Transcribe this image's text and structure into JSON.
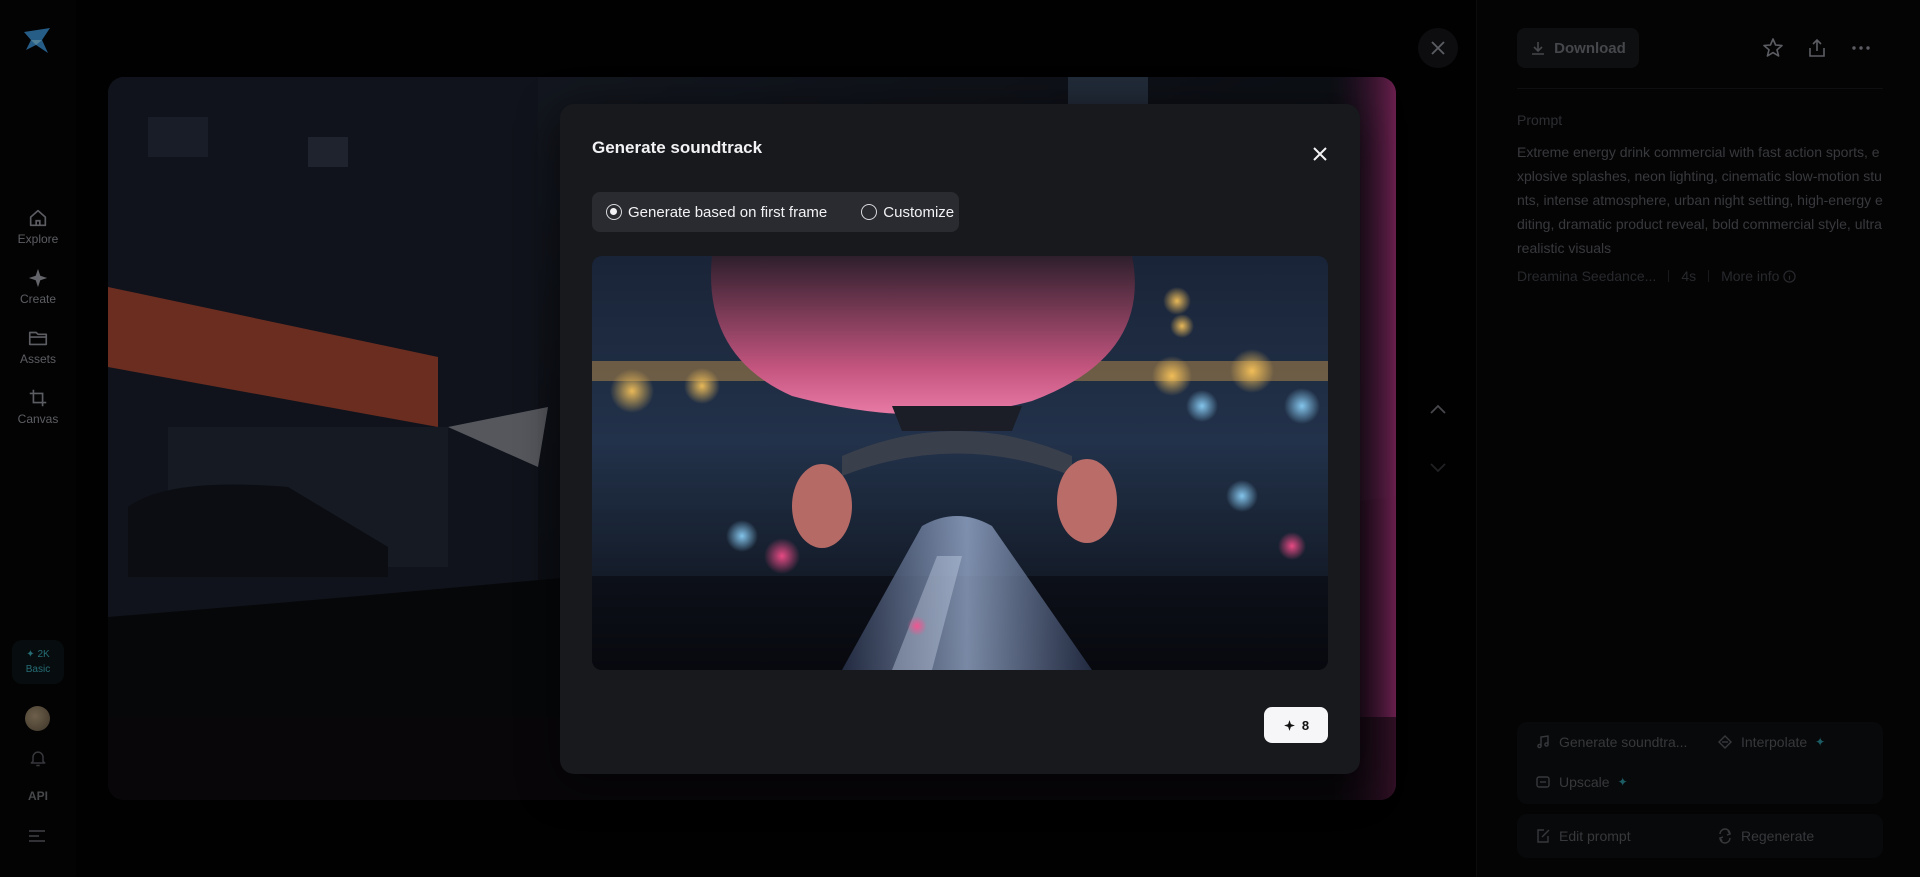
{
  "nav": {
    "items": [
      {
        "label": "Explore",
        "icon": "home-icon"
      },
      {
        "label": "Create",
        "icon": "sparkle-icon"
      },
      {
        "label": "Assets",
        "icon": "folder-icon"
      },
      {
        "label": "Canvas",
        "icon": "crop-icon"
      }
    ],
    "credits": {
      "amount": "✦ 2K",
      "plan": "Basic"
    },
    "api_label": "API"
  },
  "right_panel": {
    "download_label": "Download",
    "prompt_label": "Prompt",
    "prompt_text": "Extreme energy drink commercial with fast action sports, explosive splashes, neon lighting, cinematic slow-motion stunts, intense atmosphere, urban night setting, high-energy editing, dramatic product reveal, bold commercial style, ultra realistic visuals",
    "model": "Dreamina Seedance...",
    "duration": "4s",
    "more_info": "More info",
    "actions": {
      "generate_soundtrack": "Generate soundtra...",
      "interpolate": "Interpolate",
      "upscale": "Upscale",
      "edit_prompt": "Edit prompt",
      "regenerate": "Regenerate"
    }
  },
  "modal": {
    "title": "Generate soundtrack",
    "options": [
      "Generate based on first frame",
      "Customize"
    ],
    "selected_option": "Generate based on first frame",
    "generate_cost": "8"
  },
  "colors": {
    "accent": "#2c8f9c",
    "modal_bg": "#18191d",
    "segment_bg": "#2a2b30"
  }
}
